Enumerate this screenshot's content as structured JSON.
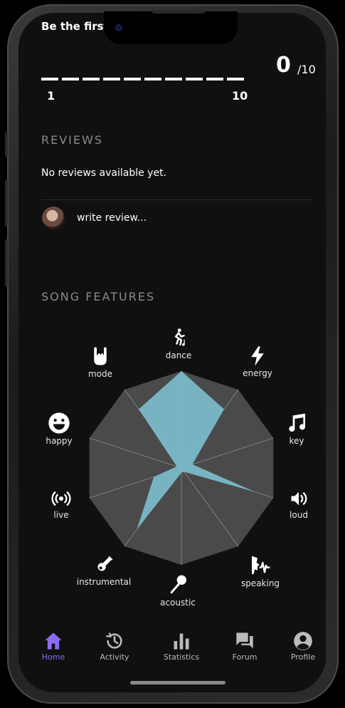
{
  "header": {
    "truncated_text": "Be the first or",
    "score_value": "0",
    "score_max": "/10",
    "scale_min_label": "1",
    "scale_max_label": "10",
    "rating_segments": 10
  },
  "reviews": {
    "title": "REVIEWS",
    "empty_text": "No reviews available yet.",
    "write_placeholder": "write review..."
  },
  "features": {
    "title": "SONG FEATURES",
    "items": [
      {
        "label": "dance",
        "icon": "dance-icon",
        "value": 1.0
      },
      {
        "label": "energy",
        "icon": "bolt-icon",
        "value": 0.75
      },
      {
        "label": "key",
        "icon": "music-note-icon",
        "value": 0.12
      },
      {
        "label": "loud",
        "icon": "speaker-icon",
        "value": 0.8
      },
      {
        "label": "speaking",
        "icon": "speaking-icon",
        "value": 0.05
      },
      {
        "label": "acoustic",
        "icon": "microphone-icon",
        "value": 0.05
      },
      {
        "label": "instrumental",
        "icon": "guitar-icon",
        "value": 0.78
      },
      {
        "label": "live",
        "icon": "broadcast-icon",
        "value": 0.3
      },
      {
        "label": "happy",
        "icon": "smile-icon",
        "value": 0.05
      },
      {
        "label": "mode",
        "icon": "rock-hand-icon",
        "value": 0.75
      }
    ],
    "fill_color": "#7ab8c8",
    "grid_color": "#4a4a4a"
  },
  "tabbar": {
    "items": [
      {
        "label": "Home",
        "icon": "home-icon",
        "active": true
      },
      {
        "label": "Activity",
        "icon": "history-icon",
        "active": false
      },
      {
        "label": "Statistics",
        "icon": "bar-chart-icon",
        "active": false
      },
      {
        "label": "Forum",
        "icon": "chat-icon",
        "active": false
      },
      {
        "label": "Profile",
        "icon": "profile-icon",
        "active": false
      }
    ],
    "active_color": "#8b6cf0"
  }
}
